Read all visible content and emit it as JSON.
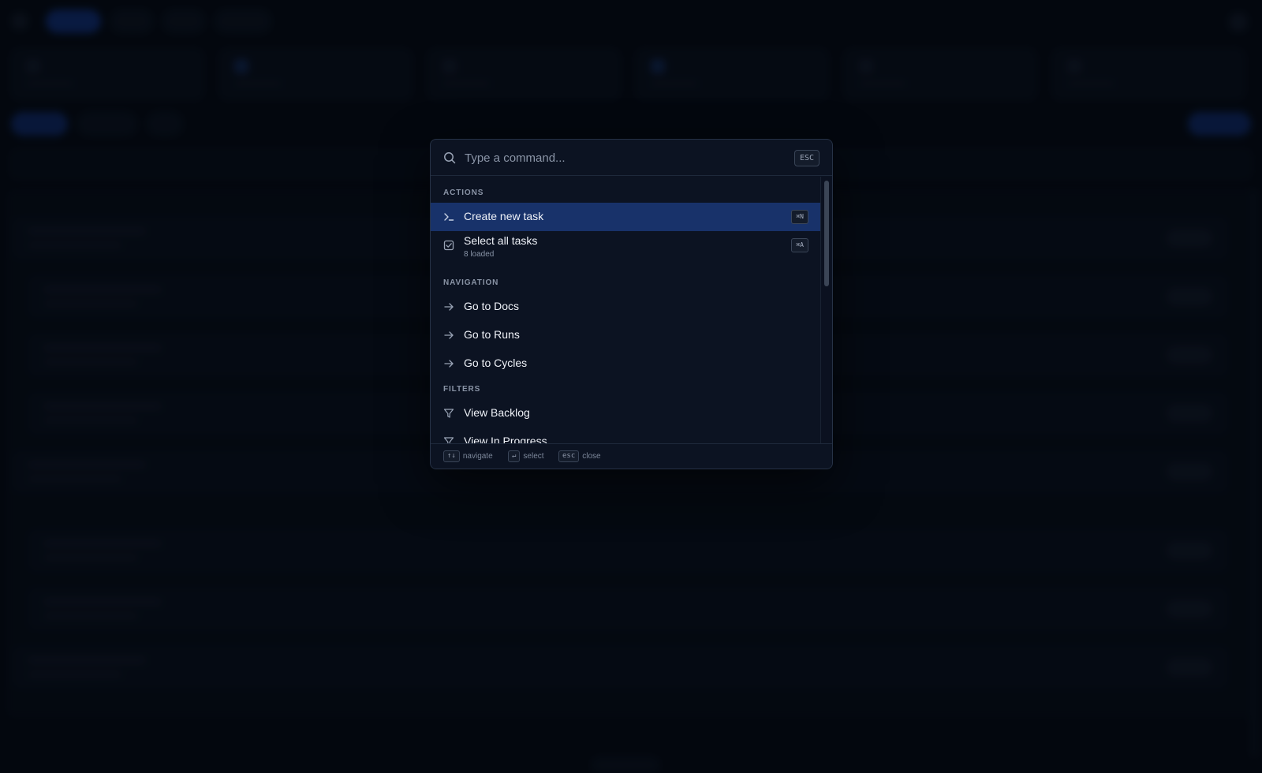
{
  "palette": {
    "search": {
      "placeholder": "Type a command...",
      "value": "",
      "esc_label": "ESC"
    },
    "sections": {
      "actions": "ACTIONS",
      "navigation": "NAVIGATION",
      "filters": "FILTERS"
    },
    "items": [
      {
        "label": "Create new task",
        "shortcut": "⌘N",
        "icon": "terminal-icon",
        "active": true
      },
      {
        "label": "Select all tasks",
        "sublabel": "8 loaded",
        "shortcut": "⌘A",
        "icon": "checkbox-icon"
      },
      {
        "label": "Go to Docs",
        "icon": "arrow-right-icon"
      },
      {
        "label": "Go to Runs",
        "icon": "arrow-right-icon"
      },
      {
        "label": "Go to Cycles",
        "icon": "arrow-right-icon"
      },
      {
        "label": "View Backlog",
        "icon": "filter-icon"
      },
      {
        "label": "View In Progress",
        "icon": "filter-icon"
      }
    ],
    "footer": {
      "navigate_key": "↑↓",
      "navigate_label": "navigate",
      "select_key": "↵",
      "select_label": "select",
      "close_key": "esc",
      "close_label": "close"
    }
  },
  "colors": {
    "background": "#050912",
    "palette_bg": "#0c1322",
    "active_item": "#18326a",
    "accent": "#1846b8"
  }
}
